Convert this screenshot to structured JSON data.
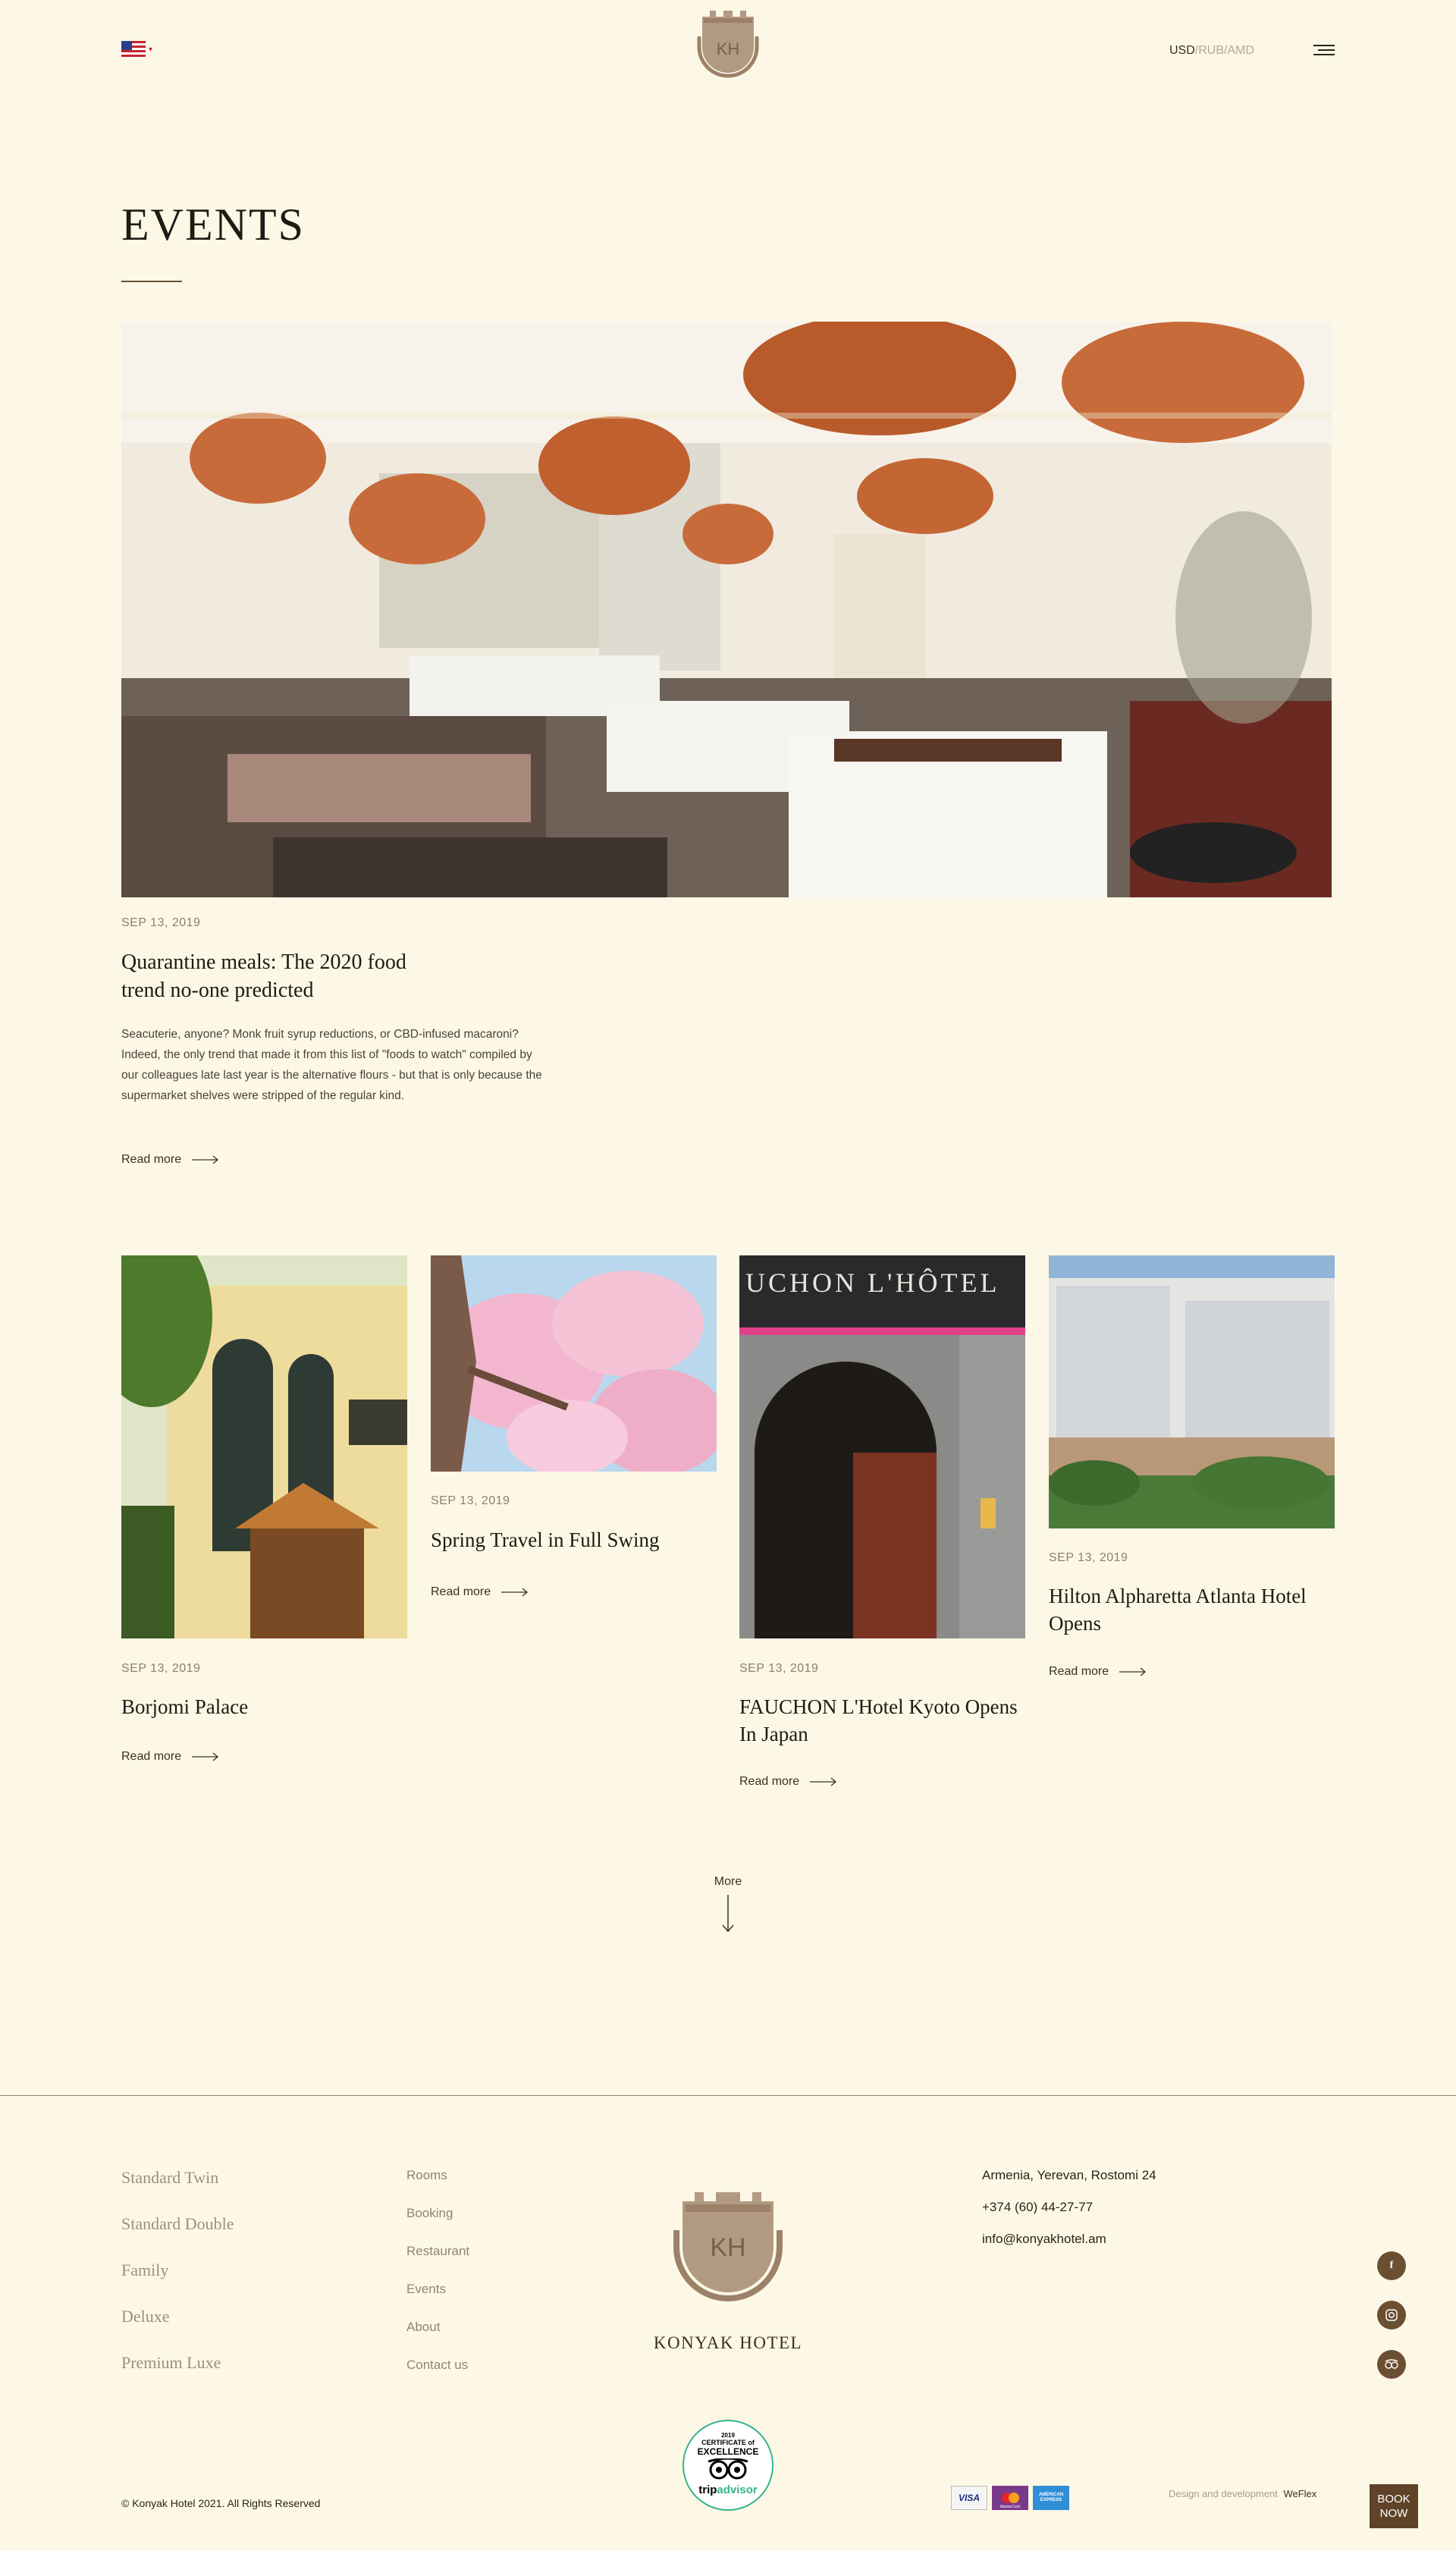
{
  "header": {
    "currency_active": "USD",
    "currency_rest": "/RUB/AMD",
    "logo_text": "KH"
  },
  "page": {
    "title": "EVENTS"
  },
  "featured": {
    "date": "SEP 13, 2019",
    "title_line1": "Quarantine meals: The 2020 food",
    "title_line2": "trend no-one predicted",
    "excerpt": "Seacuterie, anyone? Monk fruit syrup reductions, or CBD-infused macaroni? Indeed, the only trend that made it from this list of \"foods to watch\" compiled by our colleagues late last year is the alternative flours - but that is only because the supermarket shelves were stripped of the regular kind.",
    "read_more": "Read more"
  },
  "cards": [
    {
      "date": "SEP 13, 2019",
      "title": "Borjomi Palace",
      "read_more": "Read more"
    },
    {
      "date": "SEP 13, 2019",
      "title": "Spring Travel in Full Swing",
      "read_more": "Read more"
    },
    {
      "date": "SEP 13, 2019",
      "title": "FAUCHON L'Hotel Kyoto Opens In Japan",
      "read_more": "Read more"
    },
    {
      "date": "SEP 13, 2019",
      "title": "Hilton Alpharetta Atlanta Hotel Opens",
      "read_more": "Read more"
    }
  ],
  "more": {
    "label": "More"
  },
  "footer": {
    "rooms": [
      "Standard Twin",
      "Standard Double",
      "Family",
      "Deluxe",
      "Premium Luxe"
    ],
    "links": [
      "Rooms",
      "Booking",
      "Restaurant",
      "Events",
      "About",
      "Contact us"
    ],
    "logo_text": "KH",
    "hotel_name": "KONYAK HOTEL",
    "address": "Armenia, Yerevan, Rostomi 24",
    "phone": "+374 (60) 44-27-77",
    "email": "info@konyakhotel.am",
    "copyright": "© Konyak Hotel 2021. All Rights Reserved",
    "tripadvisor": {
      "year": "2019",
      "line1": "CERTIFICATE of",
      "line2": "EXCELLENCE",
      "brand_a": "trip",
      "brand_b": "advisor"
    },
    "payments": [
      "VISA",
      "MasterCard",
      "AMERICAN EXPRESS"
    ],
    "dev_label": "Design and development",
    "dev_name": "WeFlex",
    "book_line1": "BOOK",
    "book_line2": "NOW"
  },
  "colors": {
    "background": "#fdf8e6",
    "accent": "#6b4f33",
    "book_bg": "#5e4328"
  }
}
